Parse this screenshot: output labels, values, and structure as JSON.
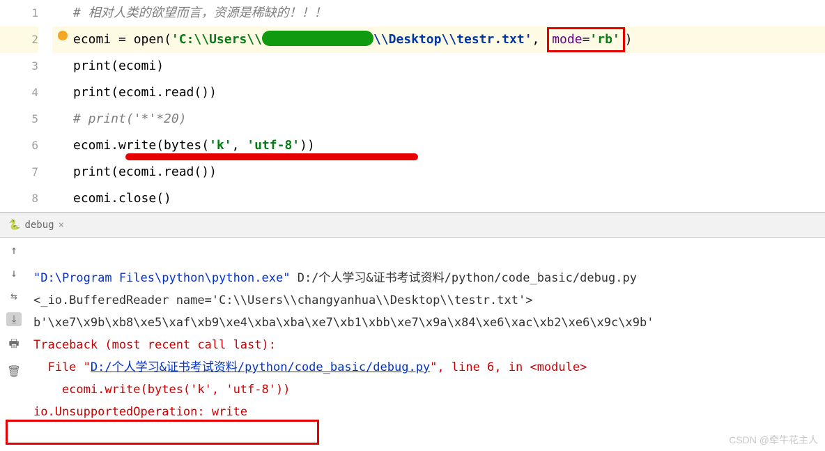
{
  "editor": {
    "lines": [
      "1",
      "2",
      "3",
      "4",
      "5",
      "6",
      "7",
      "8"
    ],
    "comment1": "# 相对人类的欲望而言，资源是稀缺的！！！",
    "l2_var": "ecomi = ",
    "l2_open": "open",
    "l2_paren1": "(",
    "l2_str1": "'C:\\\\Users\\\\",
    "l2_str2": "\\\\Desktop\\\\testr.txt'",
    "l2_comma": ", ",
    "l2_mode_k": "mode",
    "l2_mode_eq": "=",
    "l2_mode_v": "'rb'",
    "l2_paren2": ")",
    "l3": "print",
    "l3b": "(ecomi)",
    "l4": "print",
    "l4b": "(ecomi.read())",
    "l5": "# print('*'*20)",
    "l6a": "ecomi.write(",
    "l6b": "bytes",
    "l6c": "(",
    "l6d": "'k'",
    "l6e": ", ",
    "l6f": "'utf-8'",
    "l6g": "))",
    "l7": "print",
    "l7b": "(ecomi.read())",
    "l8": "ecomi.close()"
  },
  "tab": {
    "label": "debug",
    "icon": "🐍"
  },
  "console": {
    "line1a": "\"D:\\Program Files\\python\\python.exe\"",
    "line1b": " D:/个人学习&证书考试资料/python/code_basic/debug.py",
    "line2": "<_io.BufferedReader name='C:\\\\Users\\\\changyanhua\\\\Desktop\\\\testr.txt'>",
    "line3": "b'\\xe7\\x9b\\xb8\\xe5\\xaf\\xb9\\xe4\\xba\\xba\\xe7\\xb1\\xbb\\xe7\\x9a\\x84\\xe6\\xac\\xb2\\xe6\\x9c\\x9b'",
    "line4": "Traceback (most recent call last):",
    "line5a": "  File \"",
    "line5b": "D:/个人学习&证书考试资料/python/code_basic/debug.py",
    "line5c": "\", line 6, in <module>",
    "line6": "    ecomi.write(bytes('k', 'utf-8'))",
    "line7": "io.UnsupportedOperation: write"
  },
  "icons": {
    "up": "↑",
    "down": "↓",
    "wrap": "⇆",
    "scroll": "⤓",
    "print": "🖶",
    "trash": "🗑"
  },
  "watermark": "CSDN @牵牛花主人"
}
